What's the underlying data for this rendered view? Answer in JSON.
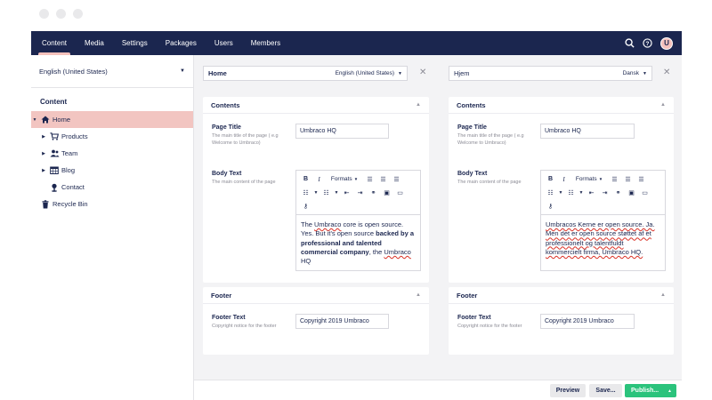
{
  "topbar": {
    "nav": [
      "Content",
      "Media",
      "Settings",
      "Packages",
      "Users",
      "Members"
    ],
    "active": "Content",
    "avatar_initial": "U",
    "icons": [
      "search-icon",
      "help-icon"
    ]
  },
  "sidebar": {
    "language": "English (United States)",
    "tree_title": "Content",
    "items": [
      {
        "label": "Home",
        "icon": "home-icon",
        "active": true
      },
      {
        "label": "Products",
        "icon": "cart-icon"
      },
      {
        "label": "Team",
        "icon": "team-icon"
      },
      {
        "label": "Blog",
        "icon": "calendar-icon"
      },
      {
        "label": "Contact",
        "icon": "pin-icon"
      },
      {
        "label": "Recycle Bin",
        "icon": "trash-icon"
      }
    ]
  },
  "left": {
    "node_name": "Home",
    "language": "English (United States)",
    "contents_title": "Contents",
    "page_title_label": "Page Title",
    "page_title_desc": "The main title of the page ( e.g Welcome to Umbraco)",
    "page_title_value": "Umbraco HQ",
    "body_label": "Body Text",
    "body_desc": "The main content of the page",
    "body_formats": "Formats",
    "body_p1": "The ",
    "body_p2": "Umbraco",
    "body_p3": " core is open source. Yes. But it's open source ",
    "body_p4": "backed by a professional and talented commercial company",
    "body_p5": ", the ",
    "body_p6": "Umbraco",
    "body_p7": " HQ",
    "footer_title": "Footer",
    "footer_label": "Footer Text",
    "footer_desc": "Copyright notice for the footer",
    "footer_value": "Copyright 2019 Umbraco"
  },
  "right": {
    "node_name": "Hjem",
    "language": "Dansk",
    "contents_title": "Contents",
    "page_title_label": "Page Title",
    "page_title_desc": "The main title of the page ( e.g Welcome to Umbraco)",
    "page_title_value": "Umbraco HQ",
    "body_label": "Body Text",
    "body_desc": "The main content of the page",
    "body_formats": "Formats",
    "body_text": "Umbracos Kerne er open source. Ja. Men det er open source støttet af et professionelt og talentfuldt kommercielt firma, Umbraco HQ.",
    "footer_title": "Footer",
    "footer_label": "Footer Text",
    "footer_desc": "Copyright notice for the footer",
    "footer_value": "Copyright 2019 Umbraco"
  },
  "actions": {
    "preview": "Preview",
    "save": "Save...",
    "publish": "Publish..."
  },
  "colors": {
    "topbar": "#1b264f",
    "accent": "#f5c1bc",
    "publish": "#2bc37c"
  }
}
